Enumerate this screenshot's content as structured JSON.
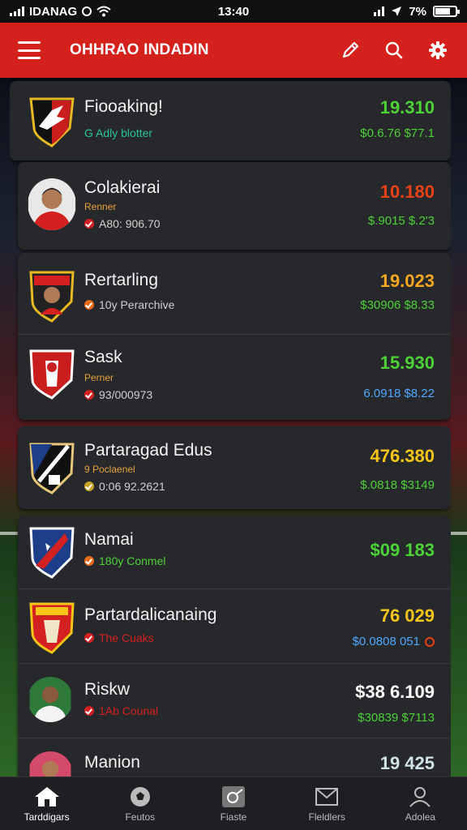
{
  "status_bar": {
    "carrier": "IDANAG",
    "time": "13:40",
    "battery": "7%"
  },
  "app_bar": {
    "title": "OHHRAO INDADIN"
  },
  "colors": {
    "accent": "#d4211c",
    "green": "#4cd137",
    "red": "#e84118",
    "yellow": "#f5c518",
    "blue": "#4ea8ff"
  },
  "rows": [
    {
      "name": "Fiooaking!",
      "sub": "G Adly blotter",
      "value": "19.310",
      "value2": "$0.6.76 $77.1"
    },
    {
      "name": "Colakierai",
      "sub": "Renner",
      "meta": "A80: 906.70",
      "value": "10.180",
      "value2": "$.9015 $.2'3"
    },
    {
      "name": "Rertarling",
      "meta": "10y Perarchive",
      "value": "19.023",
      "value2": "$30906 $8.33"
    },
    {
      "name": "Sask",
      "sub": "Perner",
      "meta": "93/000973",
      "value": "15.930",
      "value2": "6.0918 $8.22"
    },
    {
      "name": "Partaragad Edus",
      "sub": "9 Poclaenel",
      "meta": "0:06 92.2621",
      "value": "476.380",
      "value2": "$.0818 $3149"
    },
    {
      "name": "Namai",
      "meta": "180y Conmel",
      "value": "$09 183"
    },
    {
      "name": "Partardalicanaing",
      "meta": "The Cuaks",
      "value": "76 029",
      "value2": "$0.0808  051"
    },
    {
      "name": "Riskw",
      "meta": "1Ab Counal",
      "value": "$38 6.109",
      "value2": "$30839 $7113"
    },
    {
      "name": "Manion",
      "value": "19 425"
    }
  ],
  "nav": [
    {
      "label": "Tarddigars",
      "icon": "home-icon"
    },
    {
      "label": "Feutos",
      "icon": "ball-icon"
    },
    {
      "label": "Fiaste",
      "icon": "whistle-icon"
    },
    {
      "label": "Fleldlers",
      "icon": "mail-icon"
    },
    {
      "label": "Adolea",
      "icon": "profile-icon"
    }
  ]
}
